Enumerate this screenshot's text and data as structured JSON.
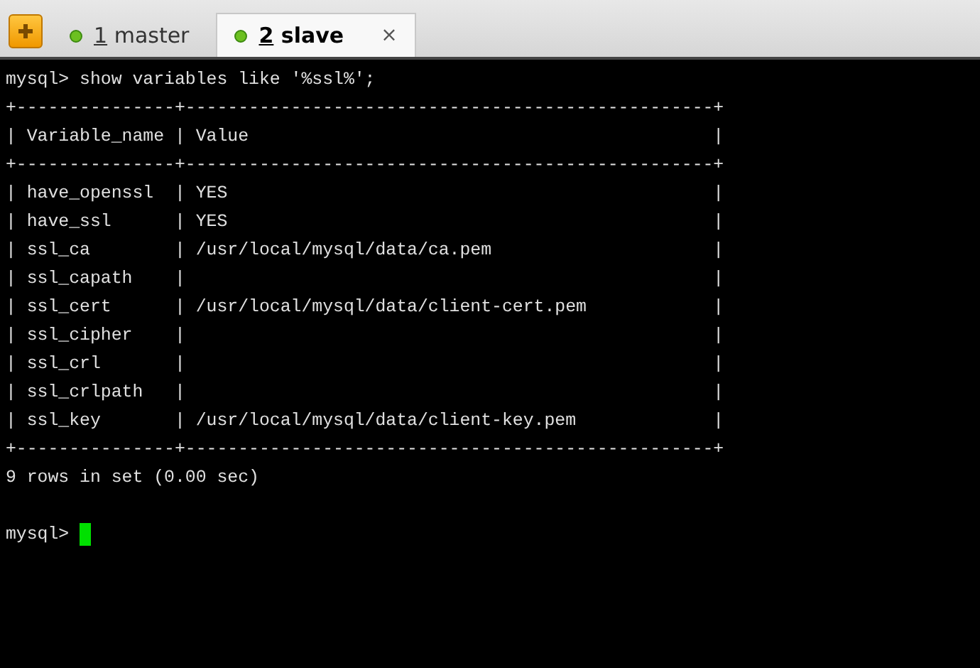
{
  "tabs": [
    {
      "number": "1",
      "label": "master",
      "selected": false
    },
    {
      "number": "2",
      "label": "slave",
      "selected": true,
      "close": "×"
    }
  ],
  "terminal": {
    "lines": [
      "mysql> show variables like '%ssl%';",
      "+---------------+--------------------------------------------------+",
      "| Variable_name | Value                                            |",
      "+---------------+--------------------------------------------------+",
      "| have_openssl  | YES                                              |",
      "| have_ssl      | YES                                              |",
      "| ssl_ca        | /usr/local/mysql/data/ca.pem                     |",
      "| ssl_capath    |                                                  |",
      "| ssl_cert      | /usr/local/mysql/data/client-cert.pem            |",
      "| ssl_cipher    |                                                  |",
      "| ssl_crl       |                                                  |",
      "| ssl_crlpath   |                                                  |",
      "| ssl_key       | /usr/local/mysql/data/client-key.pem             |",
      "+---------------+--------------------------------------------------+",
      "9 rows in set (0.00 sec)"
    ],
    "prompt": "mysql> ",
    "cursor": true
  }
}
